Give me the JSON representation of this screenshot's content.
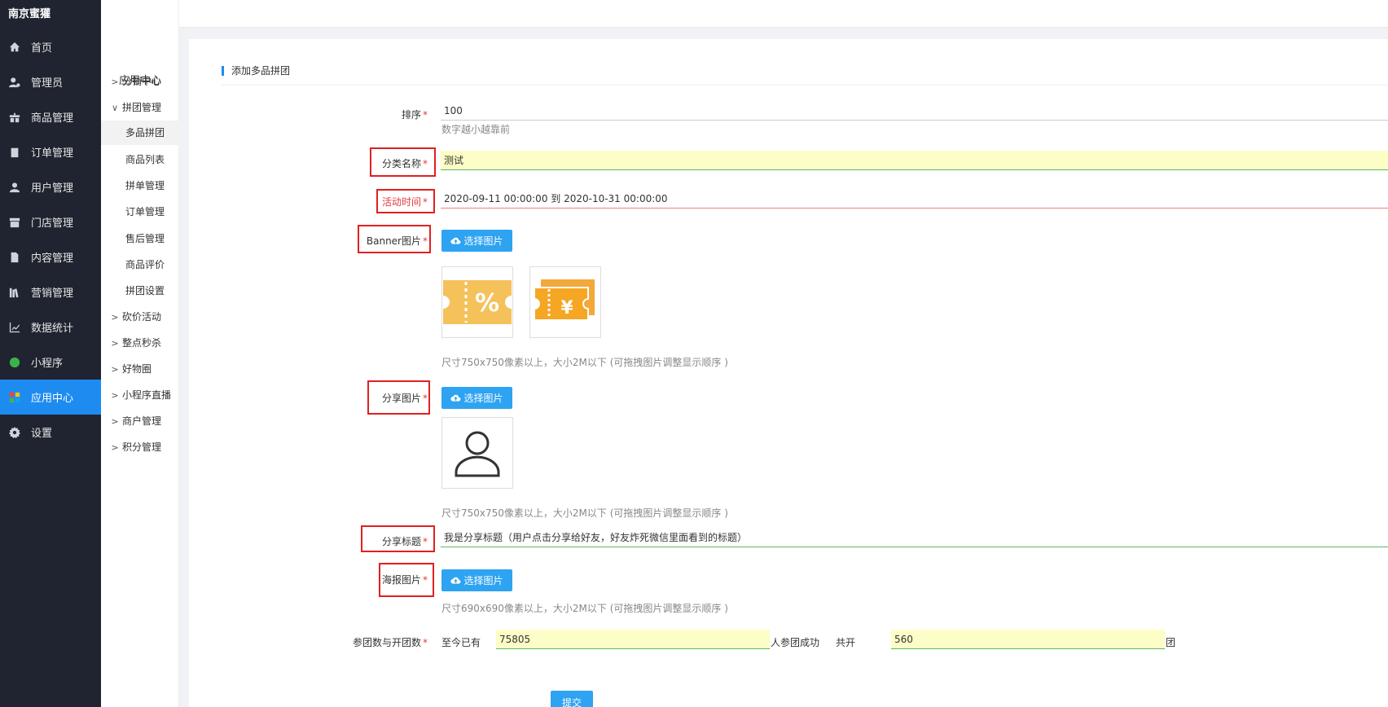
{
  "brand": "南京蜜獾",
  "nav": [
    {
      "label": "首页",
      "icon": "home-icon"
    },
    {
      "label": "管理员",
      "icon": "admin-user-icon"
    },
    {
      "label": "商品管理",
      "icon": "gift-icon"
    },
    {
      "label": "订单管理",
      "icon": "clipboard-icon"
    },
    {
      "label": "用户管理",
      "icon": "user-icon"
    },
    {
      "label": "门店管理",
      "icon": "store-icon"
    },
    {
      "label": "内容管理",
      "icon": "document-icon"
    },
    {
      "label": "营销管理",
      "icon": "books-icon"
    },
    {
      "label": "数据统计",
      "icon": "line-chart-icon"
    },
    {
      "label": "小程序",
      "icon": "miniprogram-icon"
    },
    {
      "label": "应用中心",
      "icon": "apps-icon"
    },
    {
      "label": "设置",
      "icon": "gear-icon"
    }
  ],
  "sub": {
    "title": "应用中心",
    "items": [
      {
        "label": "分销中心"
      },
      {
        "label": "拼团管理"
      },
      {
        "label": "多品拼团"
      },
      {
        "label": "商品列表"
      },
      {
        "label": "拼单管理"
      },
      {
        "label": "订单管理"
      },
      {
        "label": "售后管理"
      },
      {
        "label": "商品评价"
      },
      {
        "label": "拼团设置"
      },
      {
        "label": "砍价活动"
      },
      {
        "label": "整点秒杀"
      },
      {
        "label": "好物圈"
      },
      {
        "label": "小程序直播"
      },
      {
        "label": "商户管理"
      },
      {
        "label": "积分管理"
      }
    ]
  },
  "form": {
    "section_title": "添加多品拼团",
    "sort_label": "排序",
    "sort_value": "100",
    "sort_hint": "数字越小越靠前",
    "category_label": "分类名称",
    "category_value": "测试",
    "time_label": "活动时间",
    "time_value": "2020-09-11 00:00:00 到 2020-10-31 00:00:00",
    "banner_label": "Banner图片",
    "upload_btn": "选择图片",
    "banner_hint": "尺寸750x750像素以上，大小2M以下 (可拖拽图片调整显示顺序 )",
    "share_img_label": "分享图片",
    "share_img_hint": "尺寸750x750像素以上，大小2M以下 (可拖拽图片调整显示顺序 )",
    "share_title_label": "分享标题",
    "share_title_value": "我是分享标题（用户点击分享给好友，好友炸死微信里面看到的标题）",
    "poster_label": "海报图片",
    "poster_hint": "尺寸690x690像素以上，大小2M以下 (可拖拽图片调整显示顺序 )",
    "join_label": "参团数与开团数",
    "join_prefix": "至今已有",
    "join_value": "75805",
    "join_mid": "人参团成功",
    "open_prefix": "共开",
    "open_value": "560",
    "open_suffix": "团",
    "submit": "提交",
    "required_mark": "*"
  },
  "colors": {
    "sidebar_bg": "#1f2430",
    "accent": "#1e8bf0",
    "upload_btn": "#2ea3f2",
    "required": "#e4393c",
    "highlight_box": "#e02020",
    "input_yellow": "#fdfdc8",
    "ticket_orange": "#f5b041"
  }
}
